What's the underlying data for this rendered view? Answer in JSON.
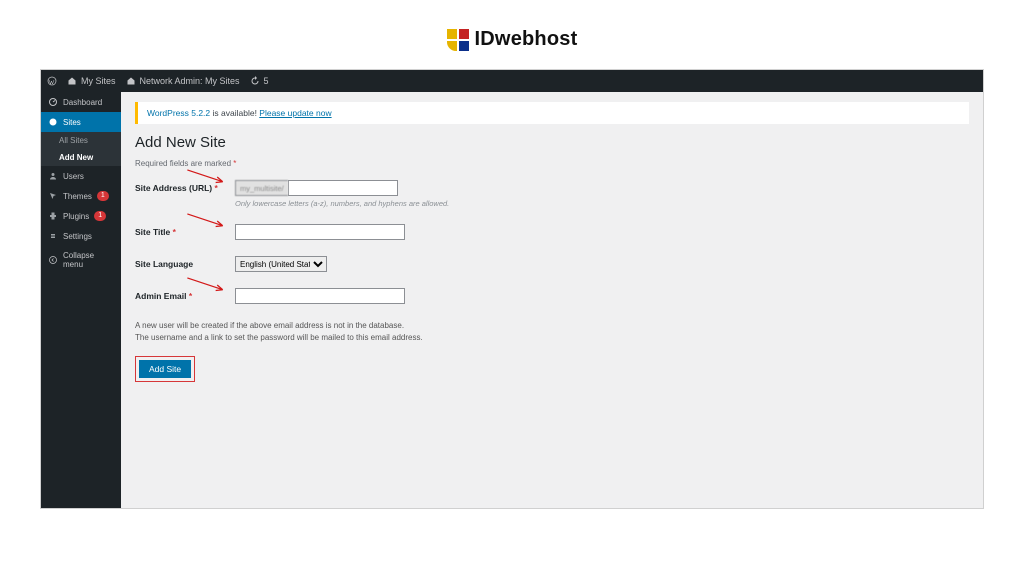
{
  "brand": "IDwebhost",
  "wpbar": {
    "mysites": "My Sites",
    "network": "Network Admin: My Sites",
    "comments": "5"
  },
  "sidebar": {
    "dashboard": "Dashboard",
    "sites": "Sites",
    "sub_all": "All Sites",
    "sub_add": "Add New",
    "users": "Users",
    "themes": "Themes",
    "themes_badge": "1",
    "plugins": "Plugins",
    "plugins_badge": "1",
    "settings": "Settings",
    "collapse": "Collapse menu"
  },
  "notice": {
    "pre": "WordPress 5.2.2",
    "mid": " is available! ",
    "link": "Please update now"
  },
  "page": {
    "title": "Add New Site",
    "required": "Required fields are marked "
  },
  "form": {
    "url_label": "Site Address (URL)",
    "url_prefix": "my_multisite/",
    "url_hint": "Only lowercase letters (a-z), numbers, and hyphens are allowed.",
    "title_label": "Site Title",
    "lang_label": "Site Language",
    "lang_value": "English (United States)",
    "email_label": "Admin Email",
    "note_l1": "A new user will be created if the above email address is not in the database.",
    "note_l2": "The username and a link to set the password will be mailed to this email address.",
    "submit": "Add Site"
  }
}
